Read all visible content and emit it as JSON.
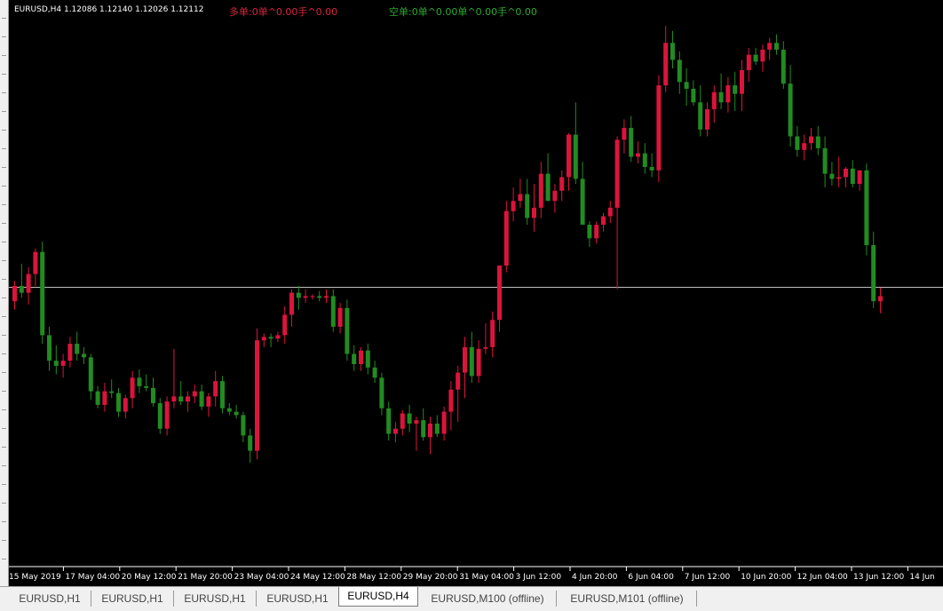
{
  "header": {
    "symbol_info": "EURUSD,H4  1.12086 1.12140 1.12026 1.12112",
    "long_info": "多单:0单^0.00手^0.00",
    "short_info": "空单:0单^0.00单^0.00手^0.00"
  },
  "colors": {
    "background": "#000000",
    "bull": "#dc143c",
    "bear": "#228b22",
    "axis_text": "#ffffff",
    "price_line": "#c0c0c0"
  },
  "tabs": [
    "EURUSD,H1",
    "EURUSD,H1",
    "EURUSD,H1",
    "EURUSD,H1",
    "EURUSD,H4",
    "EURUSD,M100 (offline)",
    "EURUSD,M101 (offline)"
  ],
  "active_tab": 4,
  "chart_data": {
    "type": "candlestick",
    "symbol": "EURUSD",
    "timeframe": "H4",
    "current_price": 1.12112,
    "ylim": [
      1.105,
      1.1375
    ],
    "x_tick_labels": [
      "15 May 2019",
      "17 May 04:00",
      "20 May 12:00",
      "21 May 20:00",
      "23 May 04:00",
      "24 May 12:00",
      "28 May 12:00",
      "29 May 20:00",
      "31 May 04:00",
      "3 Jun 12:00",
      "4 Jun 20:00",
      "6 Jun 04:00",
      "7 Jun 12:00",
      "10 Jun 20:00",
      "12 Jun 04:00",
      "13 Jun 12:00",
      "14 Jun"
    ],
    "ohlc": [
      [
        1.1203,
        1.1215,
        1.1198,
        1.1212
      ],
      [
        1.1212,
        1.1225,
        1.1205,
        1.1208
      ],
      [
        1.1208,
        1.1223,
        1.1201,
        1.1219
      ],
      [
        1.1219,
        1.1234,
        1.1212,
        1.1232
      ],
      [
        1.1232,
        1.1238,
        1.1178,
        1.1183
      ],
      [
        1.1183,
        1.1188,
        1.1162,
        1.1168
      ],
      [
        1.1168,
        1.1177,
        1.116,
        1.1165
      ],
      [
        1.1165,
        1.1172,
        1.1158,
        1.1168
      ],
      [
        1.1168,
        1.1182,
        1.1164,
        1.1178
      ],
      [
        1.1178,
        1.1185,
        1.1168,
        1.1172
      ],
      [
        1.1172,
        1.1176,
        1.1166,
        1.117
      ],
      [
        1.117,
        1.1172,
        1.1145,
        1.115
      ],
      [
        1.115,
        1.1153,
        1.114,
        1.1142
      ],
      [
        1.1142,
        1.1155,
        1.1138,
        1.115
      ],
      [
        1.115,
        1.1157,
        1.1146,
        1.1149
      ],
      [
        1.1149,
        1.1152,
        1.1135,
        1.1138
      ],
      [
        1.1138,
        1.1148,
        1.1134,
        1.1146
      ],
      [
        1.1146,
        1.1162,
        1.114,
        1.1158
      ],
      [
        1.1158,
        1.1163,
        1.1149,
        1.1153
      ],
      [
        1.1153,
        1.116,
        1.115,
        1.1152
      ],
      [
        1.1152,
        1.1158,
        1.1141,
        1.1143
      ],
      [
        1.1143,
        1.1146,
        1.1125,
        1.1128
      ],
      [
        1.1128,
        1.1147,
        1.1124,
        1.1144
      ],
      [
        1.1144,
        1.1175,
        1.114,
        1.1147
      ],
      [
        1.1147,
        1.1156,
        1.1142,
        1.1144
      ],
      [
        1.1144,
        1.115,
        1.1138,
        1.1147
      ],
      [
        1.1147,
        1.1154,
        1.1143,
        1.115
      ],
      [
        1.115,
        1.1154,
        1.1139,
        1.1141
      ],
      [
        1.1141,
        1.1149,
        1.1135,
        1.1147
      ],
      [
        1.1147,
        1.1162,
        1.1141,
        1.1156
      ],
      [
        1.1156,
        1.1159,
        1.1137,
        1.114
      ],
      [
        1.114,
        1.1143,
        1.1136,
        1.1138
      ],
      [
        1.1138,
        1.1142,
        1.1134,
        1.1136
      ],
      [
        1.1136,
        1.1138,
        1.112,
        1.1124
      ],
      [
        1.1124,
        1.1128,
        1.1108,
        1.1115
      ],
      [
        1.1115,
        1.1187,
        1.111,
        1.118
      ],
      [
        1.118,
        1.1184,
        1.1176,
        1.1182
      ],
      [
        1.1182,
        1.1184,
        1.1176,
        1.1181
      ],
      [
        1.1181,
        1.1185,
        1.1179,
        1.1183
      ],
      [
        1.1183,
        1.12,
        1.1178,
        1.1195
      ],
      [
        1.1195,
        1.121,
        1.1188,
        1.1208
      ],
      [
        1.1208,
        1.1212,
        1.1198,
        1.1205
      ],
      [
        1.1205,
        1.121,
        1.1202,
        1.1206
      ],
      [
        1.1206,
        1.1207,
        1.1204,
        1.1206
      ],
      [
        1.1206,
        1.1209,
        1.1203,
        1.1205
      ],
      [
        1.1205,
        1.121,
        1.1202,
        1.1206
      ],
      [
        1.1206,
        1.121,
        1.1185,
        1.1188
      ],
      [
        1.1188,
        1.1202,
        1.1184,
        1.1199
      ],
      [
        1.1199,
        1.1204,
        1.1168,
        1.1172
      ],
      [
        1.1172,
        1.1177,
        1.1162,
        1.1166
      ],
      [
        1.1166,
        1.1176,
        1.1162,
        1.1174
      ],
      [
        1.1174,
        1.1178,
        1.116,
        1.1164
      ],
      [
        1.1164,
        1.1168,
        1.1155,
        1.1158
      ],
      [
        1.1158,
        1.1161,
        1.1136,
        1.114
      ],
      [
        1.114,
        1.1144,
        1.1121,
        1.1125
      ],
      [
        1.1125,
        1.1132,
        1.112,
        1.1128
      ],
      [
        1.1128,
        1.1139,
        1.1124,
        1.1137
      ],
      [
        1.1137,
        1.1142,
        1.1126,
        1.1131
      ],
      [
        1.1131,
        1.1135,
        1.1115,
        1.1133
      ],
      [
        1.1133,
        1.114,
        1.1121,
        1.1123
      ],
      [
        1.1123,
        1.1135,
        1.1113,
        1.1131
      ],
      [
        1.1131,
        1.1136,
        1.1123,
        1.1125
      ],
      [
        1.1125,
        1.1141,
        1.1121,
        1.1138
      ],
      [
        1.1138,
        1.1156,
        1.1127,
        1.1151
      ],
      [
        1.1151,
        1.1165,
        1.1132,
        1.1161
      ],
      [
        1.1161,
        1.1182,
        1.1146,
        1.1176
      ],
      [
        1.1176,
        1.1185,
        1.1155,
        1.1159
      ],
      [
        1.1159,
        1.118,
        1.1155,
        1.1175
      ],
      [
        1.1175,
        1.119,
        1.1172,
        1.1176
      ],
      [
        1.1176,
        1.1197,
        1.117,
        1.1192
      ],
      [
        1.1192,
        1.122,
        1.1185,
        1.1224
      ],
      [
        1.1224,
        1.1262,
        1.122,
        1.1256
      ],
      [
        1.1256,
        1.127,
        1.125,
        1.1262
      ],
      [
        1.1262,
        1.1275,
        1.1258,
        1.1266
      ],
      [
        1.1266,
        1.1275,
        1.1248,
        1.1252
      ],
      [
        1.1252,
        1.1272,
        1.1244,
        1.1258
      ],
      [
        1.1258,
        1.1285,
        1.1252,
        1.1278
      ],
      [
        1.1278,
        1.129,
        1.1262,
        1.1262
      ],
      [
        1.1262,
        1.1272,
        1.1255,
        1.1268
      ],
      [
        1.1268,
        1.128,
        1.1262,
        1.1276
      ],
      [
        1.1276,
        1.1302,
        1.1268,
        1.1301
      ],
      [
        1.1301,
        1.132,
        1.1272,
        1.1275
      ],
      [
        1.1275,
        1.1285,
        1.1248,
        1.1248
      ],
      [
        1.1248,
        1.125,
        1.1235,
        1.124
      ],
      [
        1.124,
        1.125,
        1.1237,
        1.1248
      ],
      [
        1.1248,
        1.1255,
        1.1244,
        1.1253
      ],
      [
        1.1253,
        1.1262,
        1.1249,
        1.1258
      ],
      [
        1.1258,
        1.13,
        1.121,
        1.1298
      ],
      [
        1.1298,
        1.131,
        1.129,
        1.1305
      ],
      [
        1.1305,
        1.1312,
        1.1285,
        1.1288
      ],
      [
        1.1288,
        1.1297,
        1.1284,
        1.129
      ],
      [
        1.129,
        1.1296,
        1.1278,
        1.1282
      ],
      [
        1.1282,
        1.129,
        1.1276,
        1.128
      ],
      [
        1.128,
        1.1336,
        1.1273,
        1.133
      ],
      [
        1.133,
        1.1365,
        1.1326,
        1.1355
      ],
      [
        1.1355,
        1.1362,
        1.134,
        1.1345
      ],
      [
        1.1345,
        1.135,
        1.1325,
        1.1332
      ],
      [
        1.1332,
        1.134,
        1.1318,
        1.1328
      ],
      [
        1.1328,
        1.1333,
        1.1318,
        1.132
      ],
      [
        1.132,
        1.133,
        1.13,
        1.1304
      ],
      [
        1.1304,
        1.132,
        1.13,
        1.1316
      ],
      [
        1.1316,
        1.133,
        1.1308,
        1.1326
      ],
      [
        1.1326,
        1.1337,
        1.1316,
        1.132
      ],
      [
        1.132,
        1.1335,
        1.1314,
        1.133
      ],
      [
        1.133,
        1.1338,
        1.1315,
        1.1325
      ],
      [
        1.1325,
        1.1345,
        1.1315,
        1.1339
      ],
      [
        1.1339,
        1.1352,
        1.1332,
        1.1348
      ],
      [
        1.1348,
        1.1352,
        1.1342,
        1.1344
      ],
      [
        1.1344,
        1.1354,
        1.1338,
        1.1351
      ],
      [
        1.1351,
        1.1358,
        1.1345,
        1.1355
      ],
      [
        1.1355,
        1.136,
        1.1348,
        1.1351
      ],
      [
        1.1351,
        1.1356,
        1.1328,
        1.1331
      ],
      [
        1.1331,
        1.1342,
        1.1294,
        1.13
      ],
      [
        1.13,
        1.1306,
        1.1288,
        1.1292
      ],
      [
        1.1292,
        1.1301,
        1.1286,
        1.1296
      ],
      [
        1.1296,
        1.1305,
        1.1292,
        1.13
      ],
      [
        1.13,
        1.1306,
        1.1289,
        1.1293
      ],
      [
        1.1293,
        1.13,
        1.127,
        1.1278
      ],
      [
        1.1278,
        1.1285,
        1.1271,
        1.1275
      ],
      [
        1.1275,
        1.1288,
        1.127,
        1.1276
      ],
      [
        1.1276,
        1.1282,
        1.127,
        1.1281
      ],
      [
        1.1281,
        1.1286,
        1.127,
        1.1272
      ],
      [
        1.1272,
        1.128,
        1.1268,
        1.128
      ],
      [
        1.128,
        1.1284,
        1.123,
        1.1236
      ],
      [
        1.1236,
        1.1244,
        1.1199,
        1.1203
      ],
      [
        1.1203,
        1.1211,
        1.1196,
        1.1206
      ]
    ]
  }
}
